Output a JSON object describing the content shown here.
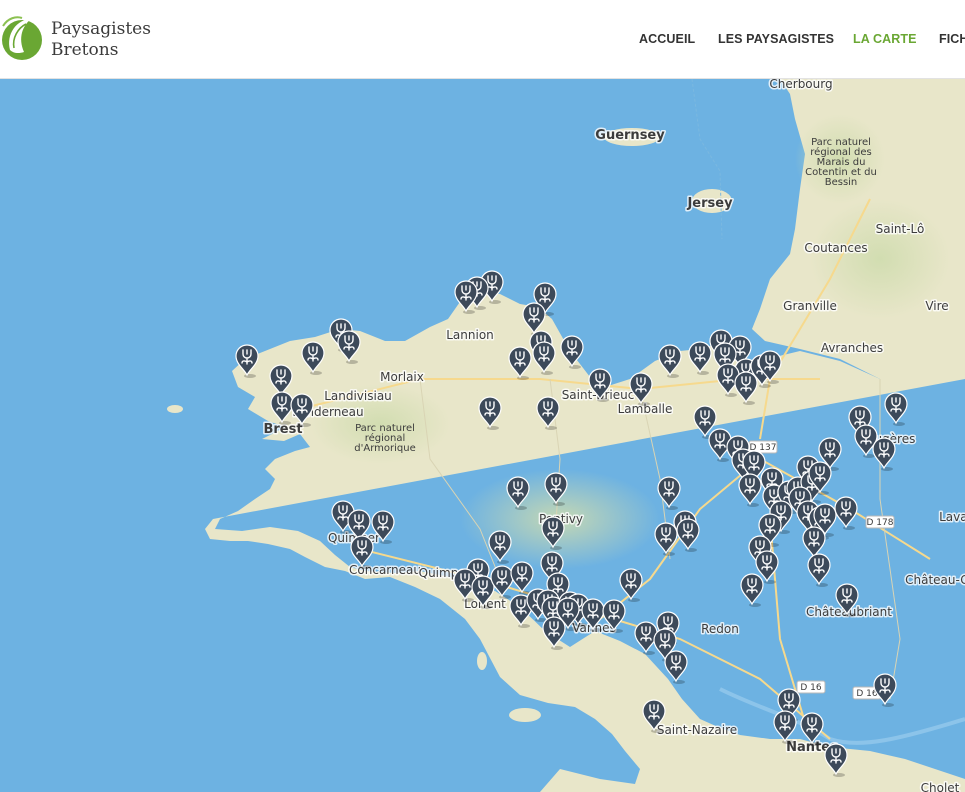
{
  "site": {
    "name_line1": "Paysagistes",
    "name_line2": "Bretons"
  },
  "nav": {
    "items": [
      {
        "label": "ACCUEIL",
        "active": false
      },
      {
        "label": "LES PAYSAGISTES",
        "active": false
      },
      {
        "label": "LA CARTE",
        "active": true
      },
      {
        "label": "FICH",
        "active": false
      }
    ],
    "active_color": "#6aa733"
  },
  "map": {
    "colors": {
      "sea": "#6db2e2",
      "land": "#e8e6c9",
      "marker": "#3d4a5a"
    },
    "marker_icon": "flower-icon",
    "place_labels": [
      {
        "name": "Cherbourg",
        "style": "town"
      },
      {
        "name": "Guernsey",
        "style": "island"
      },
      {
        "name": "Jersey",
        "style": "island"
      },
      {
        "name": "Parc naturel régional des Marais du Cotentin et du Bessin",
        "style": "park"
      },
      {
        "name": "Saint-Lô",
        "style": "town"
      },
      {
        "name": "Coutances",
        "style": "town"
      },
      {
        "name": "Granville",
        "style": "town"
      },
      {
        "name": "Vire",
        "style": "town"
      },
      {
        "name": "Avranches",
        "style": "town"
      },
      {
        "name": "Lannion",
        "style": "town"
      },
      {
        "name": "Morlaix",
        "style": "town"
      },
      {
        "name": "Landivisiau",
        "style": "town"
      },
      {
        "name": "Landerneau",
        "style": "town"
      },
      {
        "name": "Brest",
        "style": "city"
      },
      {
        "name": "Parc naturel régional d'Armorique",
        "style": "park"
      },
      {
        "name": "Saint-Brieuc",
        "style": "town"
      },
      {
        "name": "Lamballe",
        "style": "town"
      },
      {
        "name": "Fougères",
        "style": "town"
      },
      {
        "name": "Pontivy",
        "style": "town"
      },
      {
        "name": "Quimper",
        "style": "town"
      },
      {
        "name": "Concarneau",
        "style": "town"
      },
      {
        "name": "Quimperlé",
        "style": "town"
      },
      {
        "name": "Lorient",
        "style": "town"
      },
      {
        "name": "Vannes",
        "style": "town"
      },
      {
        "name": "Redon",
        "style": "town"
      },
      {
        "name": "Châteaubriant",
        "style": "town"
      },
      {
        "name": "Laval",
        "style": "town"
      },
      {
        "name": "Château-Gontier",
        "style": "town"
      },
      {
        "name": "Saint-Nazaire",
        "style": "town"
      },
      {
        "name": "Nantes",
        "style": "city"
      },
      {
        "name": "Cholet",
        "style": "town"
      }
    ],
    "road_labels": [
      "D 137",
      "D 178",
      "D 16",
      "D 16"
    ]
  }
}
